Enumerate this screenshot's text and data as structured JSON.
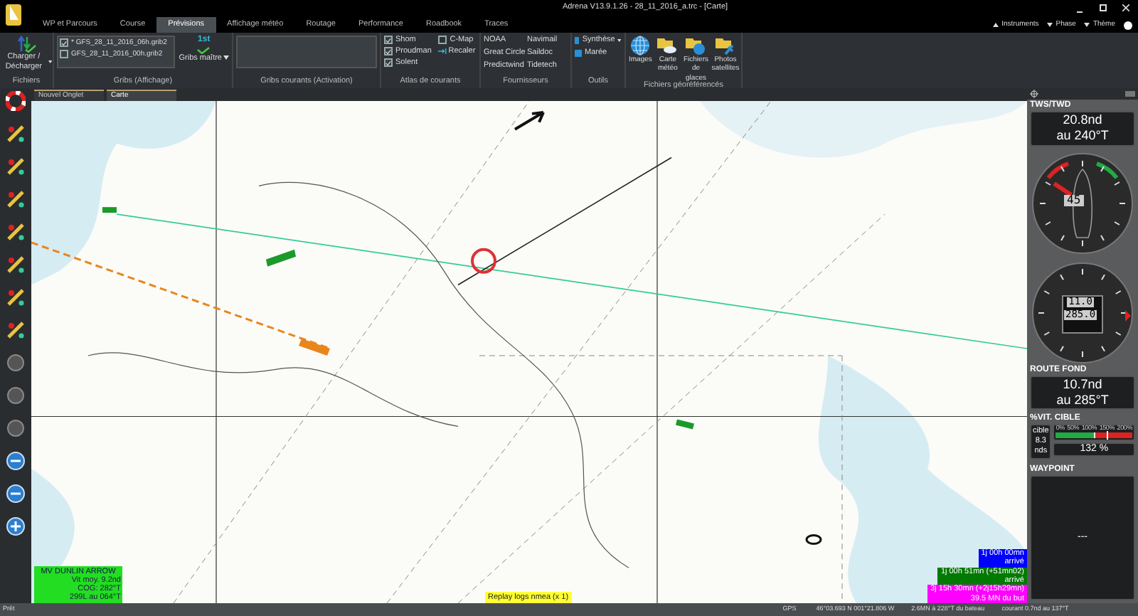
{
  "window": {
    "title": "Adrena V13.9.1.26 - 28_11_2016_a.trc - [Carte]"
  },
  "menu_tabs": [
    {
      "label": "WP et Parcours",
      "selected": false
    },
    {
      "label": "Course",
      "selected": false
    },
    {
      "label": "Prévisions",
      "selected": true
    },
    {
      "label": "Affichage météo",
      "selected": false
    },
    {
      "label": "Routage",
      "selected": false
    },
    {
      "label": "Performance",
      "selected": false
    },
    {
      "label": "Roadbook",
      "selected": false
    },
    {
      "label": "Traces",
      "selected": false
    }
  ],
  "top_right": [
    "Instruments",
    "Phase",
    "Thème"
  ],
  "ribbon": {
    "fichiers": {
      "title": "Fichiers",
      "button": "Charger / Décharger"
    },
    "gribs": {
      "title": "Gribs (Affichage)",
      "files": [
        {
          "label": "* GFS_28_11_2016_06h.grib2",
          "checked": true
        },
        {
          "label": "GFS_28_11_2016_00h.grib2",
          "checked": false
        }
      ],
      "button_icon": "1st",
      "button": "Gribs maître"
    },
    "gribs_courants": {
      "title": "Gribs courants (Activation)"
    },
    "atlas": {
      "title": "Atlas de courants",
      "options": [
        {
          "label": "Shom",
          "checked": true
        },
        {
          "label": "Proudman",
          "checked": true
        },
        {
          "label": "Solent",
          "checked": true
        },
        {
          "label": "C-Map",
          "checked": false
        }
      ],
      "button": "Recaler"
    },
    "fournisseurs": {
      "title": "Fournisseurs",
      "items": [
        "NOAA",
        "Navimail",
        "Great Circle",
        "Saildoc",
        "Predictwind",
        "Tidetech"
      ]
    },
    "outils": {
      "title": "Outils",
      "items": [
        "Synthèse",
        "Marée"
      ]
    },
    "geo": {
      "title": "Fichiers géoréférencés",
      "items": [
        {
          "label": "Images",
          "kind": "globe"
        },
        {
          "label": "Carte météo",
          "kind": "weather"
        },
        {
          "label": "Fichiers de glaces",
          "kind": "ice"
        },
        {
          "label": "Photos satellites",
          "kind": "satellite"
        }
      ]
    }
  },
  "doc_tabs": [
    {
      "label": "Nouvel Onglet",
      "selected": false
    },
    {
      "label": "Carte",
      "selected": true
    }
  ],
  "map_overlays": {
    "boat_info": {
      "name": "MV DUNLIN ARROW",
      "lines": [
        "Vit moy. 9.2nd",
        "COG: 282°T",
        "299L au 064°T"
      ]
    },
    "replay": "Replay logs nmea (x 1)",
    "eta": [
      {
        "lines": [
          "1j 00h 00mn",
          "arrivé"
        ],
        "color": "#0000ff"
      },
      {
        "lines": [
          "1j 00h 51mn (+51mn02)",
          "arrivé"
        ],
        "color": "#007a00"
      },
      {
        "lines": [
          "3j 15h 30mn (+2j15h29mn)",
          "39.5 MN du but"
        ],
        "color": "#ff00ff"
      }
    ]
  },
  "instruments": {
    "tws": {
      "title": "TWS/TWD",
      "value": "20.8nd",
      "direction": "au 240°T"
    },
    "wind_gauge": {
      "reading": "45"
    },
    "compass": {
      "speed": "11.0",
      "heading": "285.0"
    },
    "route": {
      "title": "ROUTE FOND",
      "value": "10.7nd",
      "direction": "au 285°T"
    },
    "target": {
      "title": "%VIT. CIBLE",
      "label": "cible",
      "value": "8.3",
      "unit": "nds",
      "scale": [
        "0%",
        "50%",
        "100%",
        "150%",
        "200%"
      ],
      "level": 0.66,
      "percent": "132 %"
    },
    "waypoint": {
      "title": "WAYPOINT",
      "value": "---"
    }
  },
  "status_bar": {
    "status": "Prêt",
    "gps_label": "GPS",
    "position": "46°03.693 N  001°21.806 W",
    "distance": "2.6MN à 228°T du bateau",
    "current": "courant 0.7nd au 137°T"
  }
}
